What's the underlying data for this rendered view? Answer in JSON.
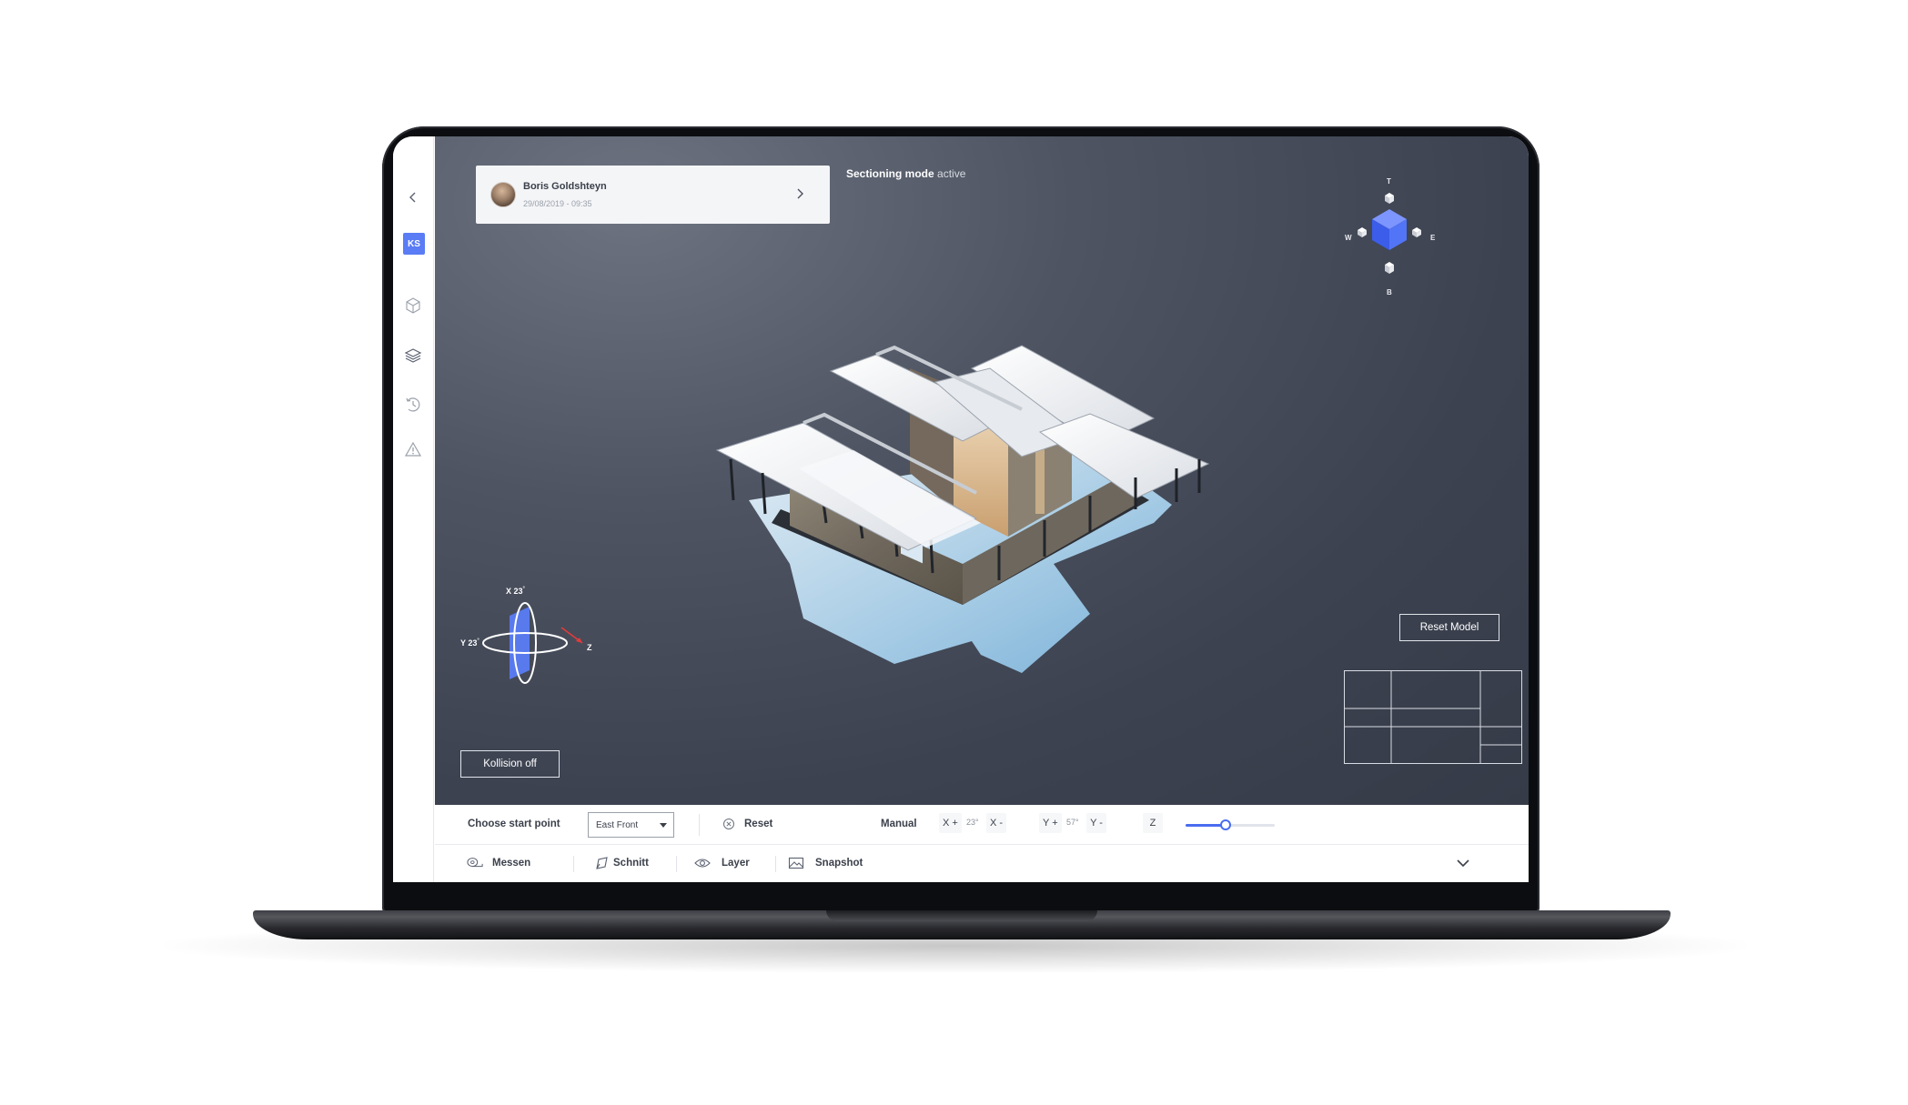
{
  "sidebar": {
    "user_initials": "KS",
    "items": [
      {
        "name": "back-icon"
      },
      {
        "name": "cube-outline-icon"
      },
      {
        "name": "layers-icon"
      },
      {
        "name": "history-icon"
      },
      {
        "name": "warning-icon"
      }
    ]
  },
  "comment": {
    "author": "Boris Goldshteyn",
    "date": "29/08/2019 - 09:35"
  },
  "status": {
    "mode_label": "Sectioning mode",
    "mode_state": "active"
  },
  "navcube": {
    "top": "T",
    "bottom": "B",
    "west": "W",
    "east": "E",
    "accent": "#4d6ef5"
  },
  "gizmo": {
    "x_label": "X 23",
    "y_label": "Y 23",
    "z_label": "Z",
    "degree": "°"
  },
  "buttons": {
    "reset_model": "Reset Model",
    "kollision": "Kollision off"
  },
  "controls": {
    "start_point_label": "Choose start point",
    "start_point_value": "East Front",
    "reset_label": "Reset",
    "manual_label": "Manual",
    "x_plus": "X +",
    "x_value": "23",
    "x_minus": "X -",
    "y_plus": "Y +",
    "y_value": "57",
    "y_minus": "Y -",
    "z_label": "Z",
    "z_slider_value": 0.45
  },
  "tools": [
    {
      "label": "Messen",
      "icon": "tape-measure-icon"
    },
    {
      "label": "Schnitt",
      "icon": "section-plane-icon"
    },
    {
      "label": "Layer",
      "icon": "eye-icon"
    },
    {
      "label": "Snapshot",
      "icon": "image-icon"
    }
  ],
  "colors": {
    "accent": "#4a6cf0",
    "viewport": "#3f4553"
  }
}
